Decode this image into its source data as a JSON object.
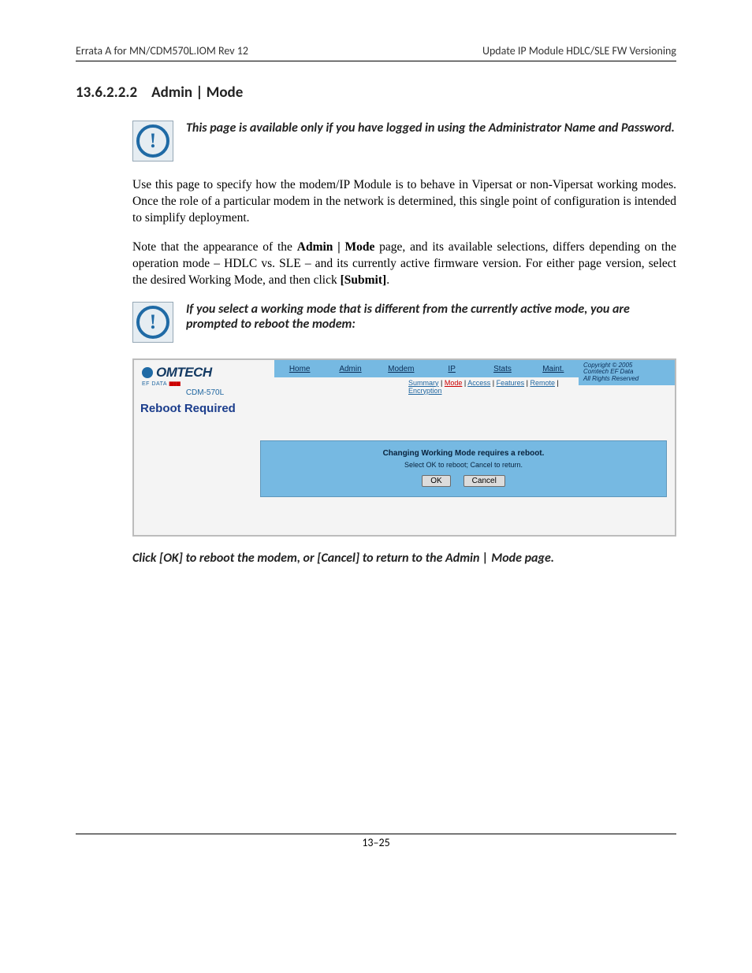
{
  "header": {
    "left": "Errata A for MN/CDM570L.IOM Rev 12",
    "right": "Update IP Module HDLC/SLE FW Versioning"
  },
  "section": {
    "number": "13.6.2.2.2",
    "title": "Admin | Mode"
  },
  "note1": {
    "alt": "info-icon",
    "text": "This page is available only if you have logged in using the Administrator Name and Password."
  },
  "para1": "Use this page to specify how the modem/IP Module is to behave in Vipersat or non-Vipersat working modes. Once the role of a particular modem in the network is determined, this single point of configuration is intended to simplify deployment.",
  "para2": {
    "pre": "Note that the appearance of the ",
    "b1": "Admin | Mode",
    "mid": " page, and its available selections, differs depending on the operation mode – HDLC vs. SLE – and its currently active firmware version. For either page version, select the desired Working Mode, and then click ",
    "b2": "[Submit]",
    "post": "."
  },
  "note2": {
    "alt": "info-icon",
    "text": "If you select a working mode that is different from the currently active mode, you are prompted to reboot the modem:"
  },
  "screenshot": {
    "logo": {
      "brand": "OMTECH",
      "subline": "EF DATA",
      "bars": "▮▮▮▮▮",
      "model": "CDM-570L"
    },
    "nav": [
      "Home",
      "Admin",
      "Modem",
      "IP",
      "Stats",
      "Maint."
    ],
    "subnav": {
      "items": [
        "Summary",
        "Mode",
        "Access",
        "Features",
        "Remote",
        "Encryption"
      ],
      "active_index": 1
    },
    "copyright": {
      "l1": "Copyright © 2005",
      "l2": "Comtech EF Data",
      "l3": "All Rights Reserved"
    },
    "heading": "Reboot Required",
    "panel": {
      "line1": "Changing Working Mode requires a reboot.",
      "line2": "Select OK to reboot; Cancel to return.",
      "ok": "OK",
      "cancel": "Cancel"
    }
  },
  "caption": "Click [OK] to reboot the modem, or [Cancel] to return to the Admin | Mode page.",
  "page_number": "13–25"
}
